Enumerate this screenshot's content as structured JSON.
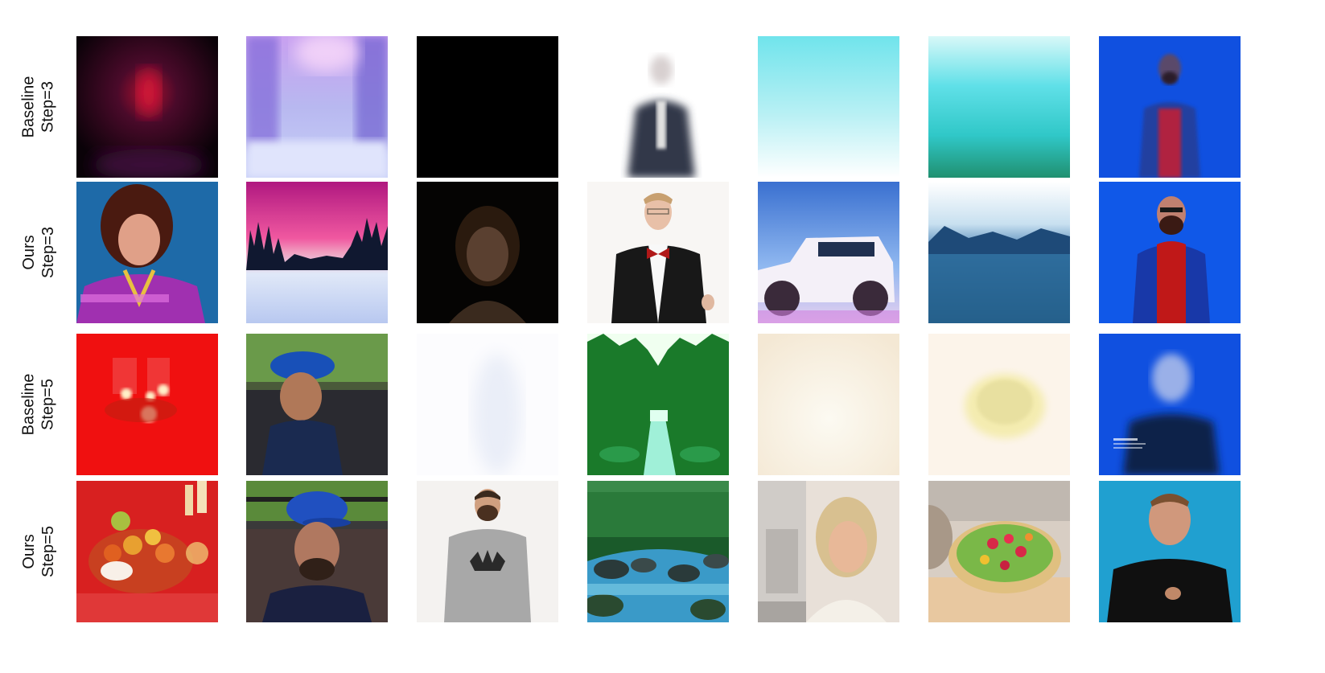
{
  "rows": [
    {
      "line1": "Baseline",
      "line2": "Step=3"
    },
    {
      "line1": "Ours",
      "line2": "Step=3"
    },
    {
      "line1": "Baseline",
      "line2": "Step=5"
    },
    {
      "line1": "Ours",
      "line2": "Step=5"
    }
  ],
  "images": {
    "r1c1": "red-glow-dark",
    "r1c2": "purple-snow-forest-blur",
    "r1c3": "black-frame",
    "r1c4": "faded-suit-figure",
    "r1c5": "pale-cyan-haze",
    "r1c6": "teal-lake-haze",
    "r1c7": "blue-man-glasses-blur",
    "r2c1": "woman-purple-jacket",
    "r2c2": "pink-sky-snow-forest",
    "r2c3": "dark-woman-portrait",
    "r2c4": "man-tuxedo-bowtie",
    "r2c5": "white-suv-blue-sky",
    "r2c6": "blue-mountain-lake",
    "r2c7": "bearded-man-red-shirt",
    "r3c1": "red-candles",
    "r3c2": "man-blue-cap-crowd-blur",
    "r3c3": "white-faded-figure",
    "r3c4": "green-forest-stream",
    "r3c5": "cream-blank",
    "r3c6": "cream-dish-blur",
    "r3c7": "blue-man-blur-text",
    "r4c1": "fruit-candles-table",
    "r4c2": "man-blue-cap-crowd",
    "r4c3": "man-grey-sweater",
    "r4c4": "forest-river-rocks",
    "r4c5": "blonde-woman-kitchen",
    "r4c6": "salad-bowl",
    "r4c7": "man-black-tshirt-teal"
  }
}
